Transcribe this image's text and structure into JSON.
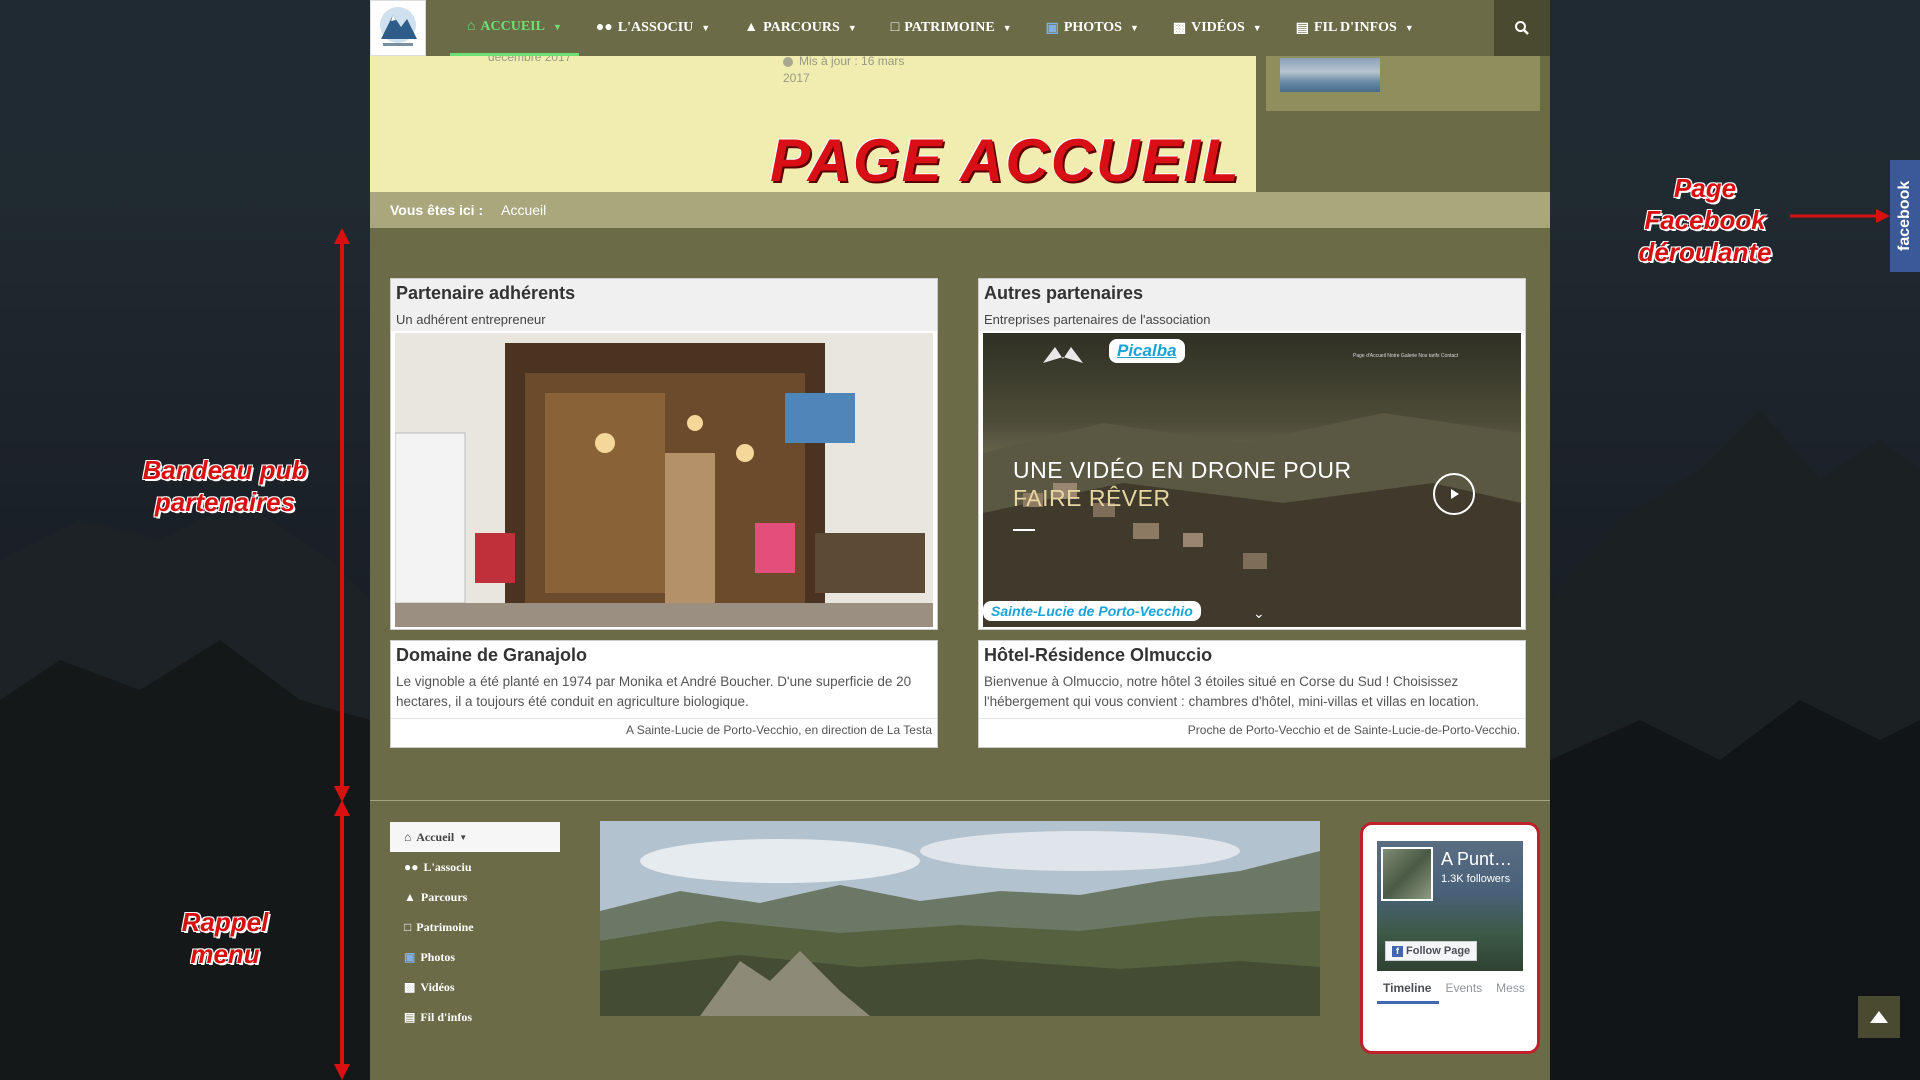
{
  "nav": {
    "items": [
      {
        "label": "ACCUEIL",
        "icon": "home-icon",
        "active": true
      },
      {
        "label": "L'ASSOCIU",
        "icon": "users-icon"
      },
      {
        "label": "PARCOURS",
        "icon": "thumbs-up-icon"
      },
      {
        "label": "PATRIMOINE",
        "icon": "bank-icon"
      },
      {
        "label": "PHOTOS",
        "icon": "image-icon"
      },
      {
        "label": "VIDÉOS",
        "icon": "film-icon"
      },
      {
        "label": "FIL D'INFOS",
        "icon": "newspaper-icon"
      }
    ]
  },
  "header": {
    "faded_left": "décembre 2017",
    "faded_mid_1": "Mis à jour : 16 mars",
    "faded_mid_2": "2017",
    "title": "PAGE ACCUEIL"
  },
  "breadcrumb": {
    "label": "Vous êtes ici :",
    "current": "Accueil"
  },
  "cards": {
    "adherents": {
      "title": "Partenaire adhérents",
      "subtitle": "Un adhérent entrepreneur"
    },
    "autres": {
      "title": "Autres partenaires",
      "subtitle": "Entreprises partenaires de l'association",
      "logo_text": "Picalba",
      "video_line1": "UNE VIDÉO EN DRONE POUR",
      "video_line2": "FAIRE RÊVER",
      "video_nav": "Page d'Accueil    Notre Galerie    Nos tarifs    Contact",
      "location_tag": "Sainte-Lucie de Porto-Vecchio"
    },
    "granajolo": {
      "title": "Domaine de Granajolo",
      "text": "Le vignoble a été planté en 1974 par Monika et André Boucher. D'une superficie de 20 hectares, il a toujours été conduit en agriculture biologique.",
      "foot": "A Sainte-Lucie de Porto-Vecchio, en direction de La Testa"
    },
    "olmuccio": {
      "title": "Hôtel-Résidence Olmuccio",
      "text": "Bienvenue à Olmuccio, notre hôtel 3 étoiles situé en Corse du Sud ! Choisissez l'hébergement qui vous convient : chambres d'hôtel, mini-villas et villas en location.",
      "foot": "Proche de Porto-Vecchio et de Sainte-Lucie-de-Porto-Vecchio."
    }
  },
  "footer_menu": [
    {
      "label": "Accueil",
      "icon": "home-icon",
      "active": true
    },
    {
      "label": "L'associu",
      "icon": "users-icon"
    },
    {
      "label": "Parcours",
      "icon": "thumbs-up-icon"
    },
    {
      "label": "Patrimoine",
      "icon": "bank-icon"
    },
    {
      "label": "Photos",
      "icon": "image-icon"
    },
    {
      "label": "Vidéos",
      "icon": "film-icon"
    },
    {
      "label": "Fil d'infos",
      "icon": "newspaper-icon"
    }
  ],
  "fb_widget": {
    "name": "A Punt…",
    "followers": "1.3K followers",
    "follow_label": "Follow Page",
    "tabs": [
      "Timeline",
      "Events",
      "Mess"
    ]
  },
  "annotations": {
    "fb_1": "Page",
    "fb_2": "Facebook",
    "fb_3": "déroulante",
    "pub_1": "Bandeau pub",
    "pub_2": "partenaires",
    "menu_1": "Rappel",
    "menu_2": "menu"
  },
  "fb_side_tab": "facebook",
  "colors": {
    "site_bg": "#6b6b47",
    "header_yellow": "#f1ecb0",
    "breadcrumb": "#a9a77b",
    "accent_green": "#6de074",
    "annotation_red": "#d81010",
    "facebook_blue": "#3b5998"
  }
}
